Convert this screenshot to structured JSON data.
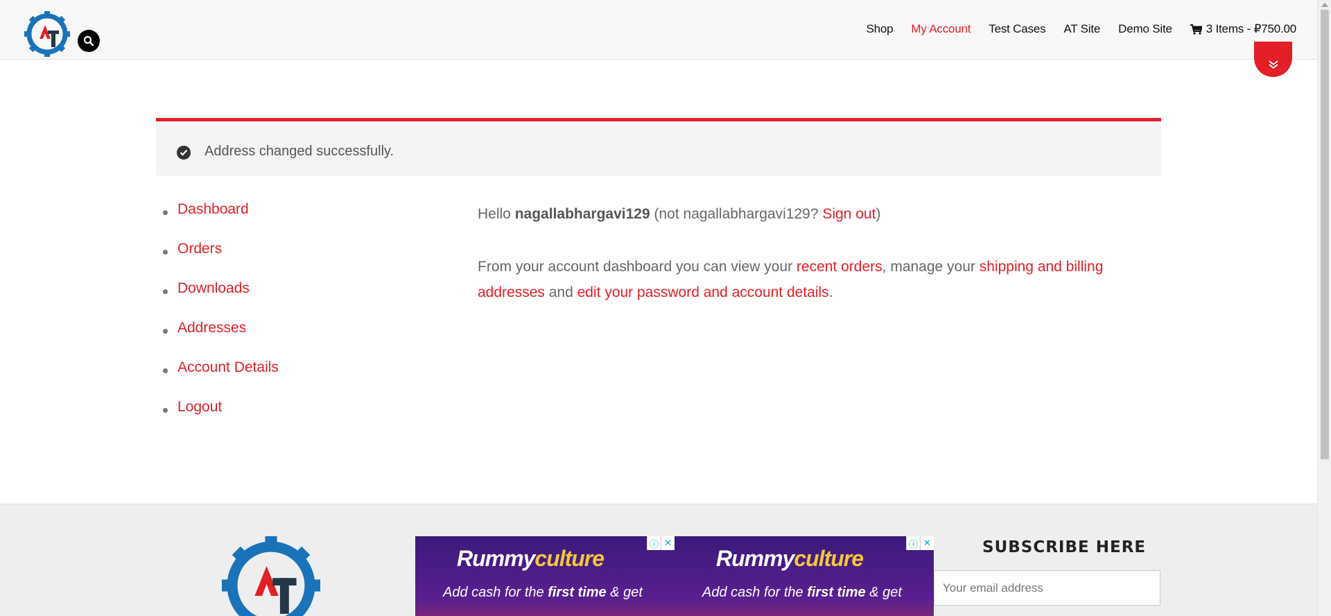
{
  "header": {
    "logo_alt": "AT",
    "search_icon": "search-icon",
    "nav": [
      {
        "label": "Shop",
        "active": false
      },
      {
        "label": "My Account",
        "active": true
      },
      {
        "label": "Test Cases",
        "active": false
      },
      {
        "label": "AT Site",
        "active": false
      },
      {
        "label": "Demo Site",
        "active": false
      }
    ],
    "cart_label": "3 Items - ₽750.00",
    "cart_icon": "cart-icon"
  },
  "notice": {
    "icon": "check-circle-icon",
    "text": "Address changed successfully."
  },
  "account_nav": [
    {
      "label": "Dashboard"
    },
    {
      "label": "Orders"
    },
    {
      "label": "Downloads"
    },
    {
      "label": "Addresses"
    },
    {
      "label": "Account Details"
    },
    {
      "label": "Logout"
    }
  ],
  "content": {
    "hello": "Hello",
    "username": "nagallabhargavi129",
    "not_prefix": "(not",
    "not_user": "nagallabhargavi129?",
    "sign_out": "Sign out",
    "close_paren": ")",
    "intro": "From your account dashboard you can view your",
    "recent_orders": "recent orders",
    "manage": ", manage your",
    "addresses_link": "shipping and billing addresses",
    "and": "and",
    "edit_link": "edit your password and account details",
    "period": "."
  },
  "footer": {
    "ads": [
      {
        "brand_a": "Rummy",
        "brand_b": "culture",
        "sub_a": "Add cash for the ",
        "sub_b": "first time",
        "sub_c": " & get"
      },
      {
        "brand_a": "Rummy",
        "brand_b": "culture",
        "sub_a": "Add cash for the ",
        "sub_b": "first time",
        "sub_c": " & get"
      }
    ],
    "subscribe_title": "SUBSCRIBE HERE",
    "email_placeholder": "Your email address"
  },
  "colors": {
    "accent": "#e21f26",
    "logo_blue": "#1a73b8",
    "logo_navy": "#253746"
  }
}
